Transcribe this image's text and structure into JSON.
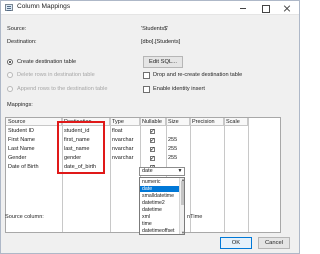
{
  "window": {
    "title": "Column Mappings",
    "controls": {
      "minimize_icon": "minimize-icon",
      "maximize_icon": "maximize-icon",
      "close_icon": "close-icon"
    }
  },
  "info": {
    "source_label": "Source:",
    "source_value": "'Students$'",
    "destination_label": "Destination:",
    "destination_value": "[dbo].[Students]"
  },
  "options": {
    "create_destination_table": "Create destination table",
    "delete_rows": "Delete rows in destination table",
    "append_rows": "Append rows to the destination table",
    "edit_sql": "Edit SQL...",
    "drop_recreate": "Drop and re-create destination table",
    "identity_insert": "Enable identity insert"
  },
  "mappings": {
    "label": "Mappings:",
    "headers": [
      "Source",
      "Destination",
      "Type",
      "Nullable",
      "Size",
      "Precision",
      "Scale"
    ],
    "rows": [
      {
        "source": "Student ID",
        "destination": "student_id",
        "type": "float",
        "nullable": true,
        "size": "",
        "precision": "",
        "scale": ""
      },
      {
        "source": "First Name",
        "destination": "first_name",
        "type": "nvarchar",
        "nullable": true,
        "size": "255",
        "precision": "",
        "scale": ""
      },
      {
        "source": "Last Name",
        "destination": "last_name",
        "type": "nvarchar",
        "nullable": true,
        "size": "255",
        "precision": "",
        "scale": ""
      },
      {
        "source": "Gender",
        "destination": "gender",
        "type": "nvarchar",
        "nullable": true,
        "size": "255",
        "precision": "",
        "scale": ""
      },
      {
        "source": "Date of Birth",
        "destination": "date_of_birth",
        "type": "date",
        "nullable": true,
        "size": "",
        "precision": "",
        "scale": ""
      }
    ]
  },
  "type_dropdown": {
    "selected": "date",
    "options": [
      "numeric",
      "date",
      "smalldatetime",
      "datetime2",
      "datetime",
      "xml",
      "time",
      "datetimeoffset"
    ]
  },
  "footer": {
    "source_column_label": "Source column:",
    "source_column_value": "nTime",
    "ok": "OK",
    "cancel": "Cancel"
  }
}
